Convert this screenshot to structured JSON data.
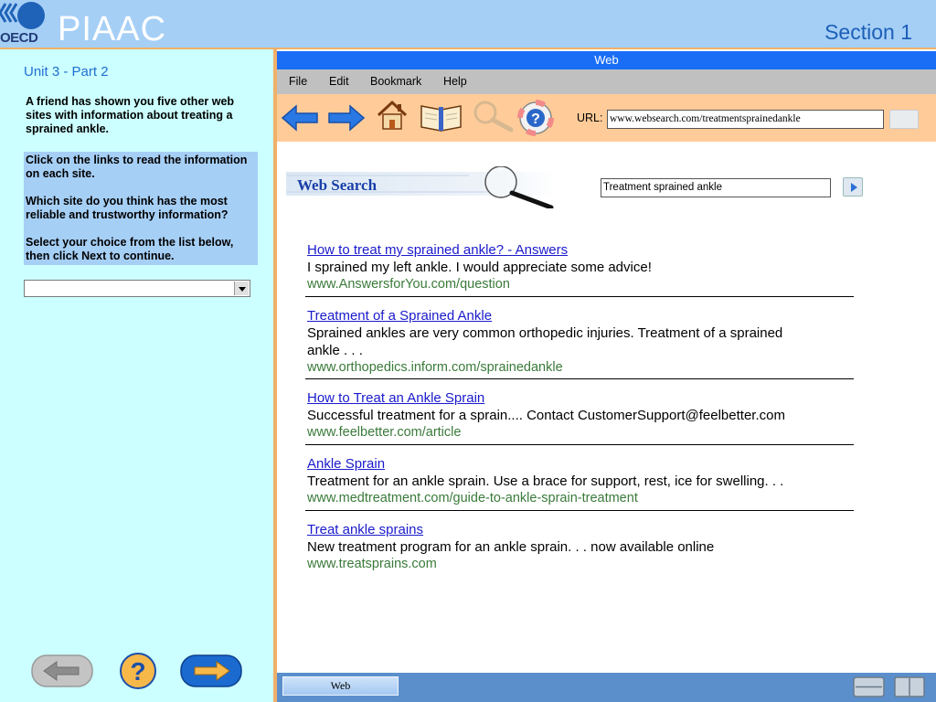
{
  "header": {
    "logo_text": "OECD",
    "program": "PIAAC",
    "section": "Section 1"
  },
  "left_panel": {
    "unit": "Unit 3 - Part 2",
    "intro": "A friend has shown you five other web sites with information about treating a sprained ankle.",
    "instructions": [
      "Click on the links to read the information on each site.",
      "Which site do you think has the most reliable and trustworthy information?",
      "Select your choice from the list below, then click Next to continue."
    ],
    "answer_select_value": "",
    "buttons": {
      "back_icon": "arrow-left-icon",
      "help_icon": "question-icon",
      "next_icon": "arrow-right-icon"
    }
  },
  "browser": {
    "window_title": "Web",
    "menu": [
      "File",
      "Edit",
      "Bookmark",
      "Help"
    ],
    "toolbar_icons": [
      "back-arrow-icon",
      "forward-arrow-icon",
      "home-icon",
      "book-icon",
      "magnifier-icon",
      "help-lifebuoy-icon"
    ],
    "url_label": "URL:",
    "url_value": "www.websearch.com/treatmentsprainedankle",
    "search_banner": "Web Search",
    "search_query": "Treatment sprained ankle",
    "results": [
      {
        "title": "How to treat my sprained ankle? - Answers",
        "description": "I sprained my left ankle.  I would appreciate some advice!",
        "url": "www.AnswersforYou.com/question"
      },
      {
        "title": "Treatment of a Sprained Ankle",
        "description": "Sprained ankles are very common orthopedic injuries. Treatment of a sprained ankle . . .",
        "url": "www.orthopedics.inform.com/sprainedankle"
      },
      {
        "title": "How to Treat an Ankle Sprain",
        "description": "Successful treatment for a sprain.... Contact CustomerSupport@feelbetter.com",
        "url": "www.feelbetter.com/article"
      },
      {
        "title": "Ankle Sprain",
        "description": "Treatment for an ankle sprain.  Use a brace for support, rest, ice for swelling. . .",
        "url": "www.medtreatment.com/guide-to-ankle-sprain-treatment"
      },
      {
        "title": "Treat ankle sprains",
        "description": "New treatment program for an ankle sprain. . . now available online",
        "url": "www.treatsprains.com"
      }
    ],
    "taskbar_item": "Web"
  },
  "colors": {
    "header_bg": "#a6cff6",
    "left_panel_bg": "#ccffff",
    "accent_orange": "#f0b069",
    "title_bar_blue": "#1a6ef5",
    "toolbar_peach": "#ffcc99",
    "link_blue": "#1a1acc",
    "url_green": "#3a7a3a",
    "taskbar_blue": "#5b8fcc"
  }
}
